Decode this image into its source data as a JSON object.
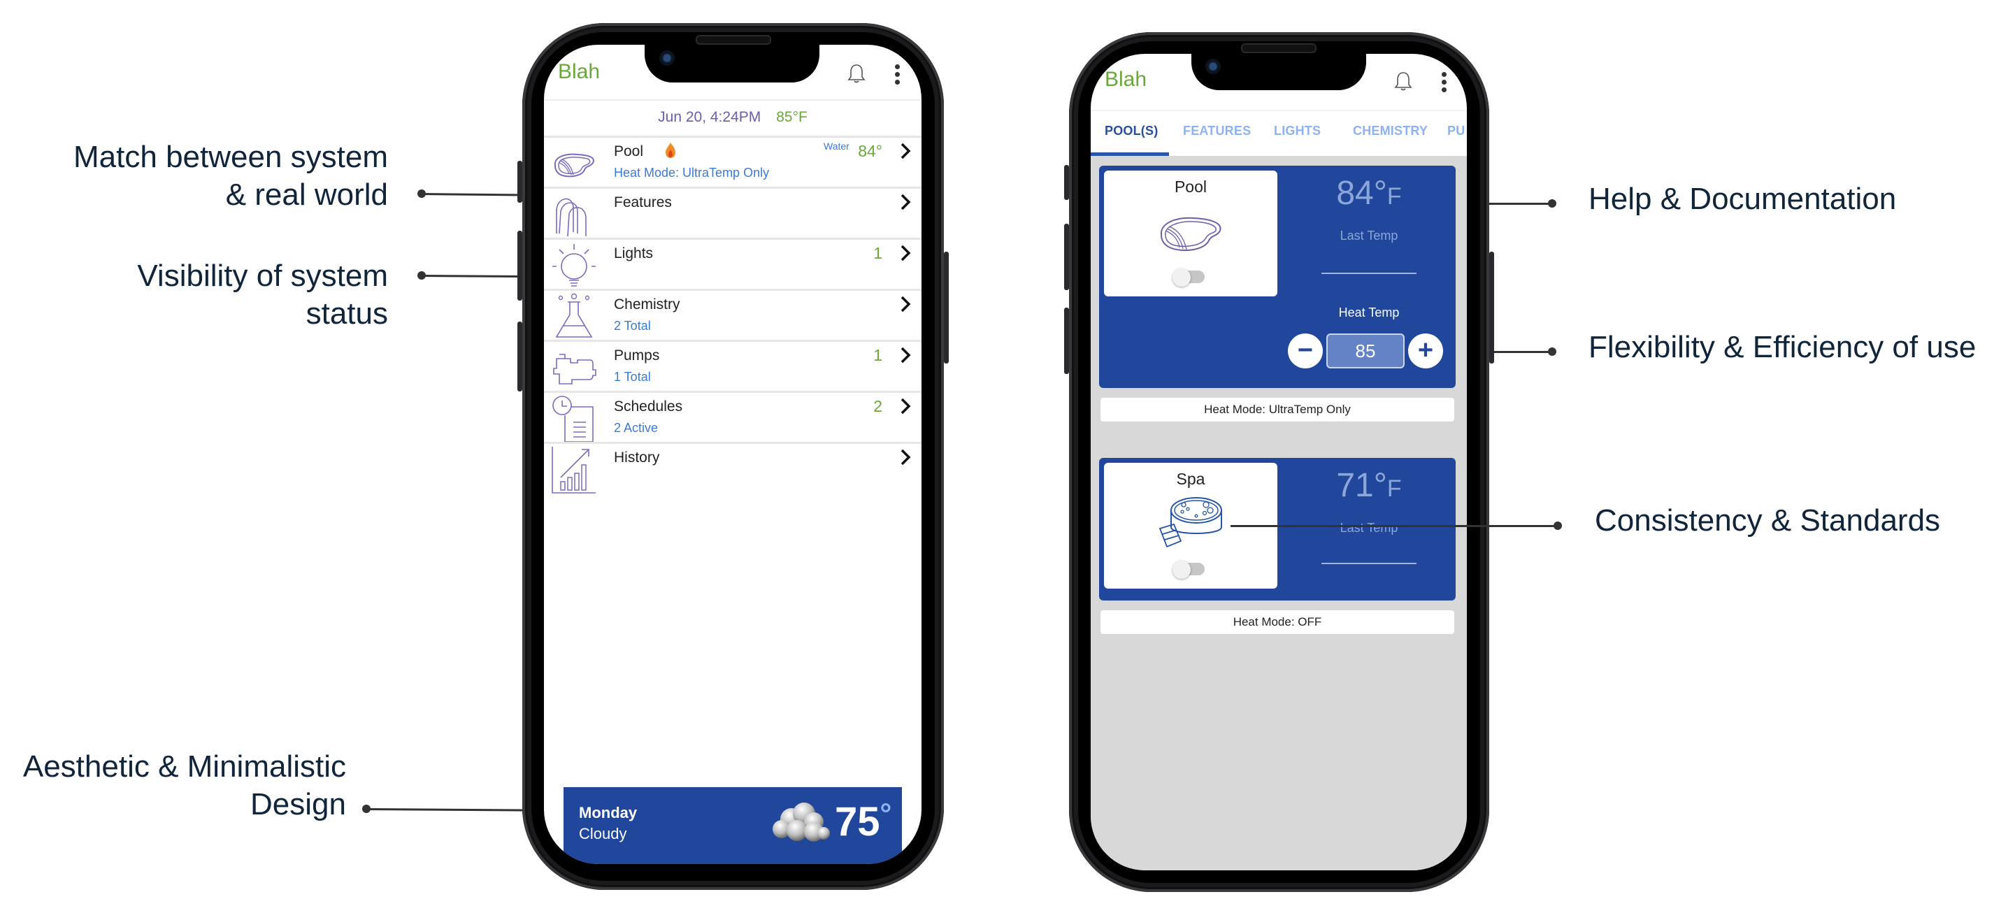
{
  "annotations": {
    "match": "Match between system & real world",
    "match_line1": "Match between system",
    "match_line2": "& real world",
    "visibility_line1": "Visibility of system",
    "visibility_line2": "status",
    "aesthetic_line1": "Aesthetic & Minimalistic",
    "aesthetic_line2": "Design",
    "help": "Help & Documentation",
    "flexibility": "Flexibility & Efficiency of use",
    "consistency": "Consistency & Standards"
  },
  "left_phone": {
    "app_title": "Blah",
    "icons": {
      "notifications": "bell-icon",
      "menu": "more-vertical-icon"
    },
    "date": "Jun 20,  4:24PM",
    "air_temp": "85°F",
    "rows": [
      {
        "title": "Pool",
        "subtitle": "Heat Mode: UltraTemp Only",
        "badge_icon": "flame-icon",
        "water_label": "Water",
        "count": "84°",
        "icon": "pool-icon"
      },
      {
        "title": "Features",
        "subtitle": "",
        "count": "",
        "icon": "fountain-icon"
      },
      {
        "title": "Lights",
        "subtitle": "",
        "count": "1",
        "icon": "light-bulb-icon"
      },
      {
        "title": "Chemistry",
        "subtitle": "2 Total",
        "count": "",
        "icon": "flask-icon"
      },
      {
        "title": "Pumps",
        "subtitle": "1 Total",
        "count": "1",
        "icon": "pump-icon"
      },
      {
        "title": "Schedules",
        "subtitle": "2 Active",
        "count": "2",
        "icon": "schedule-icon"
      },
      {
        "title": "History",
        "subtitle": "",
        "count": "",
        "icon": "chart-icon"
      }
    ],
    "weather": {
      "day": "Monday",
      "condition": "Cloudy",
      "temp": "75",
      "degree": "°",
      "icon": "cloud-icon"
    }
  },
  "right_phone": {
    "app_title": "Blah",
    "tabs": [
      {
        "label": "POOL(S)",
        "active": true
      },
      {
        "label": "FEATURES",
        "active": false
      },
      {
        "label": "LIGHTS",
        "active": false
      },
      {
        "label": "CHEMISTRY",
        "active": false
      },
      {
        "label": "PU",
        "active": false
      }
    ],
    "bodies": [
      {
        "name": "Pool",
        "temp": "84°",
        "unit": "F",
        "last_temp_label": "Last Temp",
        "heat_temp_label": "Heat Temp",
        "setpoint": "85",
        "heat_mode": "Heat Mode: UltraTemp Only",
        "on": false
      },
      {
        "name": "Spa",
        "temp": "71°",
        "unit": "F",
        "last_temp_label": "Last Temp",
        "heat_mode": "Heat Mode: OFF",
        "on": false
      }
    ],
    "stepper": {
      "minus": "−",
      "plus": "+"
    }
  },
  "colors": {
    "brand_green": "#6aa83a",
    "link_blue": "#3a7bd5",
    "card_blue": "#20479c",
    "icon_purple": "#7a6cc0",
    "annotation_text": "#10243a"
  }
}
